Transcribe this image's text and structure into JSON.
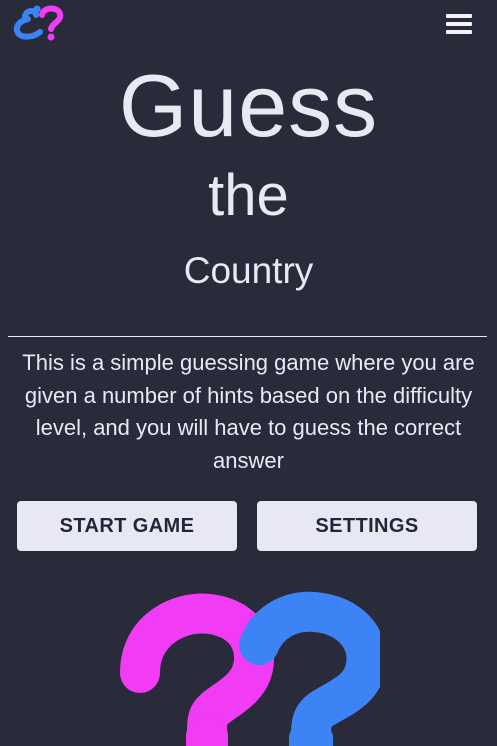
{
  "header": {
    "logo_icon": "question-marks-logo",
    "menu_icon": "hamburger-menu-icon"
  },
  "title": {
    "line1": "Guess",
    "line2": "the",
    "line3": "Country"
  },
  "description": "This is a simple guessing game where you are given a number of hints based on the difficulty level, and you will have to guess the correct answer",
  "buttons": {
    "start": "START GAME",
    "settings": "SETTINGS"
  },
  "colors": {
    "background": "#2a2b3a",
    "text": "#e9e9f4",
    "button_bg": "#e8e8f5",
    "button_text": "#24253a",
    "pink": "#f23bf4",
    "blue": "#3c83f5"
  },
  "hero_icon": "question-marks-icon"
}
